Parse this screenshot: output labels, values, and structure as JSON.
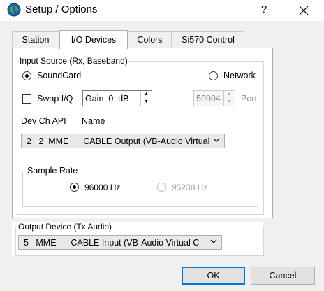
{
  "window": {
    "title": "Setup / Options",
    "help_symbol": "?",
    "close_symbol": "✕",
    "icon": "globe-icon"
  },
  "tabs": [
    {
      "label": "Station",
      "active": false
    },
    {
      "label": "I/O Devices",
      "active": true
    },
    {
      "label": "Colors",
      "active": false
    },
    {
      "label": "Si570 Control",
      "active": false
    }
  ],
  "input_source": {
    "group_label": "Input Source (Rx, Baseband)",
    "soundcard_label": "SoundCard",
    "soundcard_checked": true,
    "network_label": "Network",
    "network_checked": false,
    "swap_iq_label": "Swap I/Q",
    "swap_iq_checked": false,
    "gain_value": "Gain  0  dB",
    "port_value": "50004",
    "port_label": "Port",
    "dev_ch_api_label": "Dev Ch API",
    "name_label": "Name",
    "device_selected": "2   2  MME      CABLE Output (VB-Audio Virtual",
    "sample_rate": {
      "group_label": "Sample Rate",
      "rate1_label": "96000 Hz",
      "rate1_checked": true,
      "rate2_label": "95238 Hz",
      "rate2_checked": false
    }
  },
  "output_device": {
    "group_label": "Output Device (Tx Audio)",
    "device_selected": "5   MME      CABLE Input (VB-Audio Virtual C"
  },
  "buttons": {
    "ok_label": "OK",
    "cancel_label": "Cancel"
  },
  "colors": {
    "accent": "#0078d7",
    "tab_border": "#adadad"
  }
}
